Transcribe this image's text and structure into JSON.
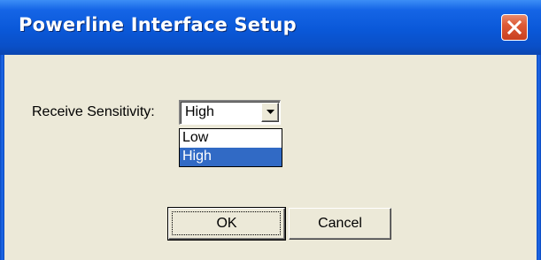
{
  "window": {
    "title": "Powerline Interface Setup"
  },
  "form": {
    "receive_sensitivity_label": "Receive Sensitivity:",
    "receive_sensitivity_value": "High",
    "options": [
      "Low",
      "High"
    ],
    "selected_option": "High"
  },
  "buttons": {
    "ok_label": "OK",
    "cancel_label": "Cancel"
  },
  "colors": {
    "titlebar": "#0a58d8",
    "client_background": "#ece9d8",
    "selection": "#316ac5",
    "close_button": "#dd5a36"
  },
  "icons": {
    "close": "close-icon",
    "dropdown_arrow": "chevron-down-icon"
  }
}
